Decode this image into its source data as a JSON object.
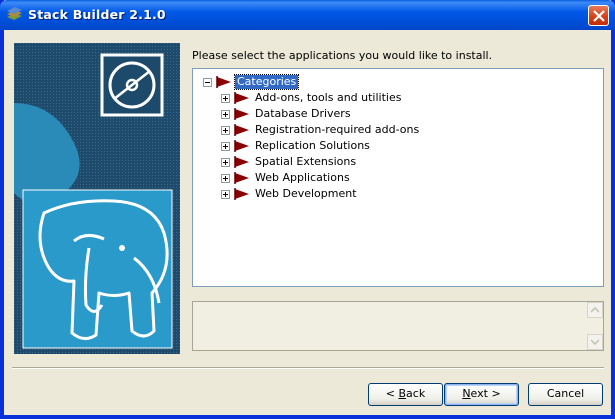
{
  "window": {
    "title": "Stack Builder 2.1.0"
  },
  "prompt": "Please select the applications you would like to install.",
  "tree": {
    "root": {
      "label": "Categories",
      "expanded": true,
      "selected": true
    },
    "items": [
      {
        "label": "Add-ons, tools and utilities"
      },
      {
        "label": "Database Drivers"
      },
      {
        "label": "Registration-required add-ons"
      },
      {
        "label": "Replication Solutions"
      },
      {
        "label": "Spatial Extensions"
      },
      {
        "label": "Web Applications"
      },
      {
        "label": "Web Development"
      }
    ]
  },
  "description": {
    "text": ""
  },
  "buttons": {
    "back": {
      "prefix": "< ",
      "mnemonic": "B",
      "rest": "ack"
    },
    "next": {
      "mnemonic": "N",
      "rest": "ext >"
    },
    "cancel": {
      "label": "Cancel"
    }
  },
  "colors": {
    "titlebar": "#0058e6",
    "selection": "#316ac5",
    "flag": "#8b0000",
    "banner": "#1d4a6a"
  }
}
